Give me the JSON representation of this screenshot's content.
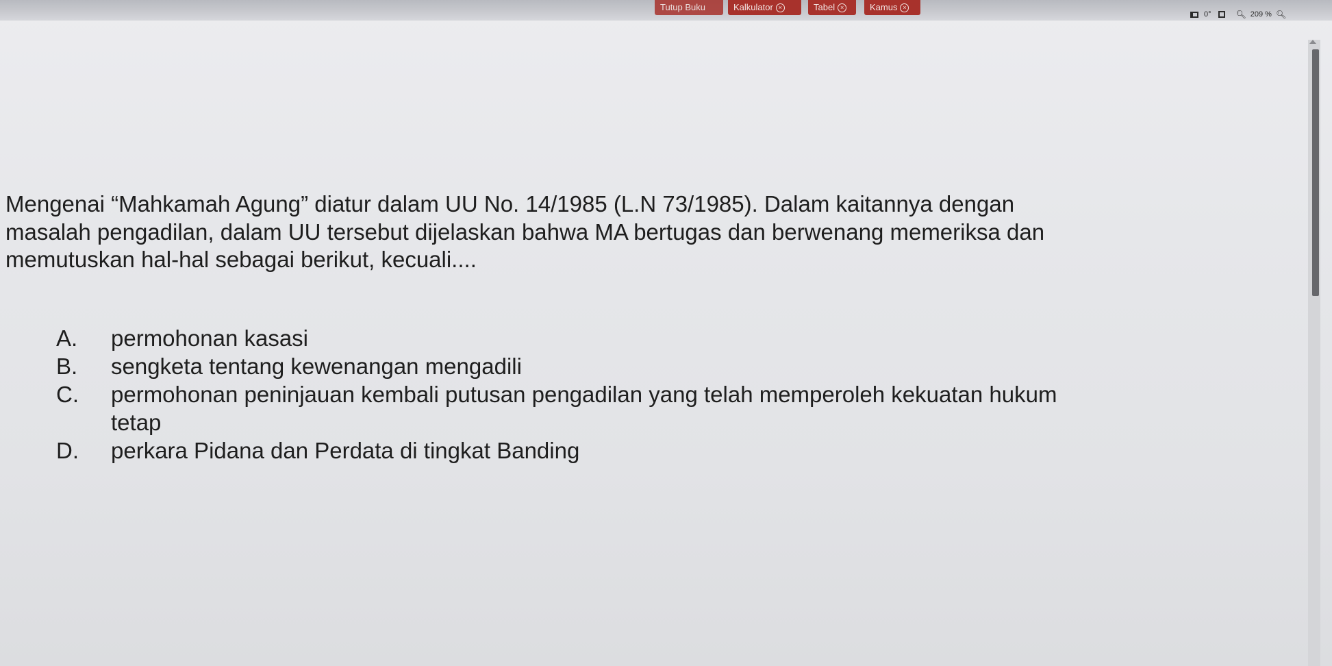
{
  "toolbar": {
    "tabs": [
      {
        "label": "Tutup Buku"
      },
      {
        "label": "Kalkulator"
      },
      {
        "label": "Tabel"
      },
      {
        "label": "Kamus"
      }
    ],
    "rotation": "0°",
    "zoom_level": "209 %"
  },
  "question": {
    "text": "Mengenai “Mahkamah Agung” diatur dalam UU No. 14/1985 (L.N 73/1985). Dalam kaitannya dengan masalah pengadilan, dalam UU tersebut dijelaskan bahwa MA bertugas dan berwenang memeriksa dan memutuskan hal-hal sebagai berikut, kecuali....",
    "options": [
      {
        "letter": "A.",
        "text": "permohonan kasasi"
      },
      {
        "letter": "B.",
        "text": "sengketa tentang kewenangan mengadili"
      },
      {
        "letter": "C.",
        "text": "permohonan peninjauan kembali putusan pengadilan yang telah memperoleh kekuatan hukum tetap"
      },
      {
        "letter": "D.",
        "text": "perkara Pidana dan Perdata di tingkat Banding"
      }
    ]
  },
  "colors": {
    "tab_red": "#a8322c",
    "page_bg": "#e6e7ea",
    "text": "#1e1e1e"
  }
}
